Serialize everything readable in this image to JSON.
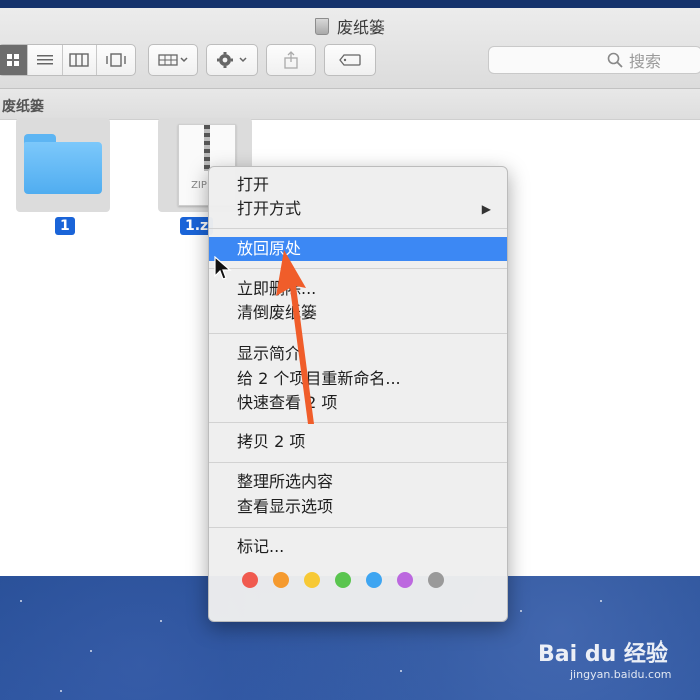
{
  "window": {
    "title": "废纸篓"
  },
  "toolbar": {
    "search_placeholder": "搜索",
    "view_icons": [
      "icon-grid-icon",
      "list-icon",
      "columns-icon",
      "cover-flow-icon"
    ]
  },
  "pathbar": {
    "label": "废纸篓"
  },
  "files": [
    {
      "name": "1",
      "kind": "folder"
    },
    {
      "name": "1.z",
      "kind": "zip",
      "icon_text": "ZIP"
    }
  ],
  "context_menu": {
    "items": [
      {
        "label": "打开"
      },
      {
        "label": "打开方式",
        "submenu": true
      },
      {
        "label": "放回原处",
        "highlighted": true
      },
      {
        "label": "立即删除..."
      },
      {
        "label": "清倒废纸篓"
      },
      {
        "label": "显示简介"
      },
      {
        "label": "给 2 个项目重新命名..."
      },
      {
        "label": "快速查看 2 项"
      },
      {
        "label": "拷贝 2 项"
      },
      {
        "label": "整理所选内容"
      },
      {
        "label": "查看显示选项"
      },
      {
        "label": "标记..."
      }
    ],
    "submenu_arrow": "▶",
    "tag_colors": [
      "#f05a4f",
      "#f59a2f",
      "#f7c935",
      "#5ac54f",
      "#3ea5f1",
      "#bc68df",
      "#9a9a9a"
    ]
  },
  "watermark": {
    "brand": "Bai du 经验",
    "url": "jingyan.baidu.com"
  }
}
